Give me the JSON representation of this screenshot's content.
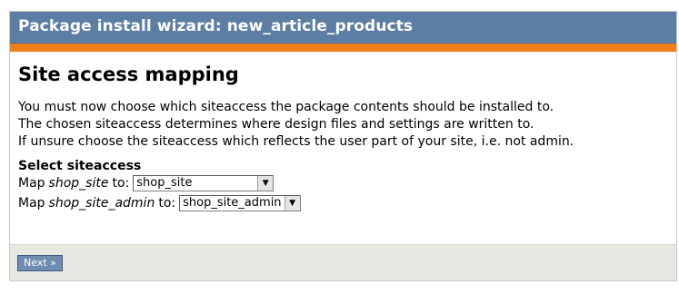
{
  "header": {
    "title": "Package install wizard: new_article_products"
  },
  "main": {
    "section_title": "Site access mapping",
    "description": [
      "You must now choose which siteaccess the package contents should be installed to.",
      "The chosen siteaccess determines where design files and settings are written to.",
      "If unsure choose the siteaccess which reflects the user part of your site, i.e. not admin."
    ],
    "select_heading": "Select siteaccess",
    "mappings": [
      {
        "prefix": "Map",
        "name": "shop_site",
        "suffix": "to:",
        "selected": "shop_site"
      },
      {
        "prefix": "Map",
        "name": "shop_site_admin",
        "suffix": "to:",
        "selected": "shop_site_admin"
      }
    ]
  },
  "footer": {
    "next_label": "Next »"
  },
  "colors": {
    "header_bg": "#5d7ea4",
    "accent": "#ef7d1a",
    "footer_bg": "#e8e8e2",
    "button_bg": "#6f8db0"
  },
  "icons": {
    "dropdown": "triangle-down-icon"
  }
}
